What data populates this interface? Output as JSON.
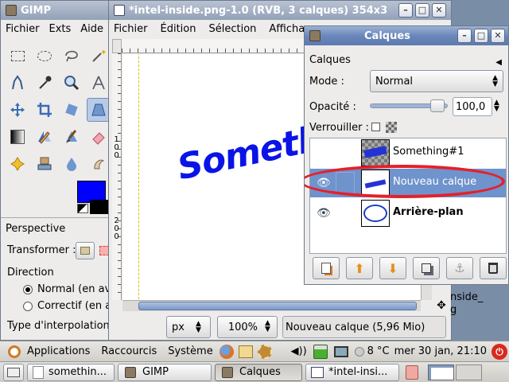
{
  "toolbox": {
    "title": "GIMP",
    "menu": [
      "Fichier",
      "Exts",
      "Aide"
    ],
    "panel_title": "Perspective",
    "transform_label": "Transformer :",
    "direction_label": "Direction",
    "direction_options": [
      "Normal (en av",
      "Correctif (en a"
    ],
    "interp_label": "Type d'interpolation"
  },
  "image_window": {
    "title": "*intel-inside.png-1.0 (RVB, 3 calques) 354x3",
    "menu": [
      "Fichier",
      "Édition",
      "Sélection",
      "Affichag"
    ],
    "ruler_v": [
      "1",
      "0",
      "0",
      "2",
      "0",
      "0"
    ],
    "canvas_text": "Somethin",
    "unit": "px",
    "zoom": "100%",
    "status": "Nouveau calque (5,96 Mio)",
    "behind_text": "nside_",
    "behind_text2": "g"
  },
  "layers": {
    "title": "Calques",
    "subtitle": "Calques",
    "mode_label": "Mode :",
    "mode_value": "Normal",
    "opacity_label": "Opacité :",
    "opacity_value": "100,0",
    "opacity_level": 1.0,
    "lock_label": "Verrouiller :",
    "items": [
      {
        "name": "Something#1",
        "visible": false,
        "selected": false
      },
      {
        "name": "Nouveau calque",
        "visible": true,
        "selected": true
      },
      {
        "name": "Arrière-plan",
        "visible": true,
        "selected": false
      }
    ],
    "highlight_color": "#e5202a",
    "select_color": "#6f93cc"
  },
  "panel": {
    "menus": [
      "Applications",
      "Raccourcis",
      "Système"
    ],
    "weather": "8 °C",
    "clock": "mer 30 jan, 21:10"
  },
  "taskbar": {
    "items": [
      "somethin...",
      "GIMP",
      "Calques",
      "*intel-insi..."
    ]
  }
}
